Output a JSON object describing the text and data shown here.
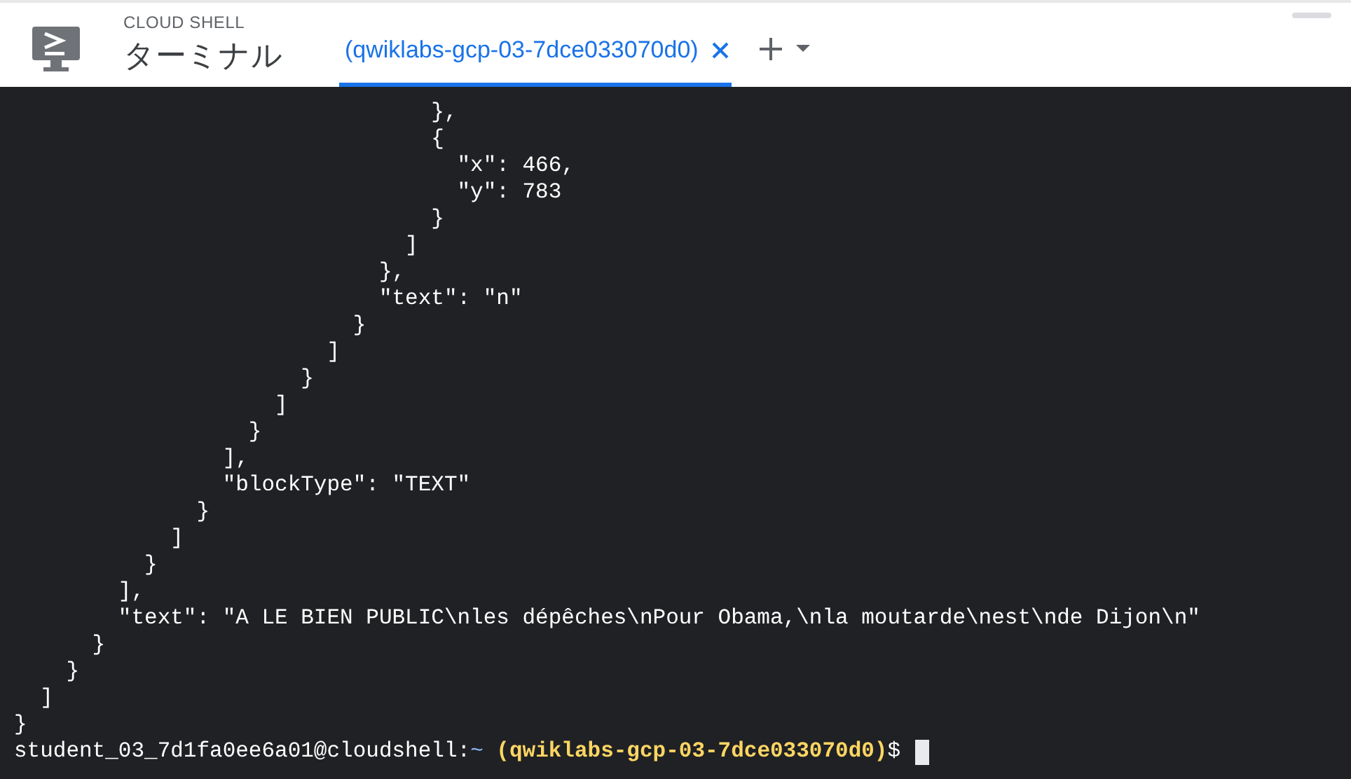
{
  "header": {
    "product": "CLOUD SHELL",
    "title": "ターミナル",
    "tabs": [
      {
        "label": "(qwiklabs-gcp-03-7dce033070d0)",
        "selected": true
      }
    ]
  },
  "terminal": {
    "lines": [
      "                                },",
      "                                {",
      "                                  \"x\": 466,",
      "                                  \"y\": 783",
      "                                }",
      "                              ]",
      "                            },",
      "                            \"text\": \"n\"",
      "                          }",
      "                        ]",
      "                      }",
      "                    ]",
      "                  }",
      "                ],",
      "                \"blockType\": \"TEXT\"",
      "              }",
      "            ]",
      "          }",
      "        ],",
      "        \"text\": \"A LE BIEN PUBLIC\\nles dépêches\\nPour Obama,\\nla moutarde\\nest\\nde Dijon\\n\"",
      "      }",
      "    }",
      "  ]",
      "}"
    ],
    "prompt": {
      "user": "student_03_7d1fa0ee6a01@cloudshell:",
      "path": "~",
      "project": "(qwiklabs-gcp-03-7dce033070d0)",
      "symbol": "$"
    }
  }
}
